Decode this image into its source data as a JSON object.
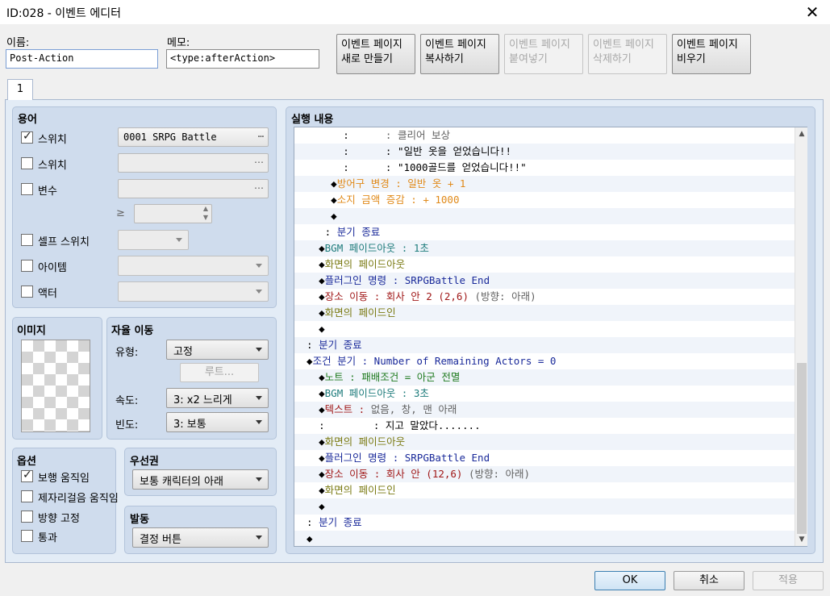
{
  "window": {
    "title": "ID:028 - 이벤트 에디터",
    "close_icon": "close-icon"
  },
  "header": {
    "name_label": "이름:",
    "name_value": "Post-Action",
    "memo_label": "메모:",
    "memo_value": "<type:afterAction>",
    "page_buttons": [
      {
        "line1": "이벤트 페이지",
        "line2": "새로 만들기",
        "enabled": true
      },
      {
        "line1": "이벤트 페이지",
        "line2": "복사하기",
        "enabled": true
      },
      {
        "line1": "이벤트 페이지",
        "line2": "붙여넣기",
        "enabled": false
      },
      {
        "line1": "이벤트 페이지",
        "line2": "삭제하기",
        "enabled": false
      },
      {
        "line1": "이벤트 페이지",
        "line2": "비우기",
        "enabled": true
      }
    ]
  },
  "tabs": [
    {
      "label": "1"
    }
  ],
  "conditions": {
    "title": "용어",
    "switch1_label": "스위치",
    "switch1_value": "0001 SRPG Battle",
    "switch2_label": "스위치",
    "variable_label": "변수",
    "gte_symbol": "≥",
    "self_switch_label": "셀프 스위치",
    "item_label": "아이템",
    "actor_label": "액터"
  },
  "image": {
    "title": "이미지"
  },
  "autonomous": {
    "title": "자율 이동",
    "type_label": "유형:",
    "type_value": "고정",
    "route_label": "루트...",
    "speed_label": "속도:",
    "speed_value": "3: x2 느리게",
    "freq_label": "빈도:",
    "freq_value": "3: 보통"
  },
  "options": {
    "title": "옵션",
    "walking": "보행 움직임",
    "stepping": "제자리걸음 움직임",
    "dir_fix": "방향 고정",
    "through": "통과"
  },
  "priority": {
    "title": "우선권",
    "value": "보통 캐릭터의 아래"
  },
  "trigger": {
    "title": "발동",
    "value": "결정 버튼"
  },
  "contents": {
    "title": "실행 내용",
    "lines": [
      [
        {
          "t": "        :      ",
          "c": ""
        },
        {
          "t": ": 클리어 보상",
          "c": "gray"
        }
      ],
      [
        {
          "t": "        :      ",
          "c": ""
        },
        {
          "t": ": \"일반 옷을 얻었습니다!!",
          "c": ""
        }
      ],
      [
        {
          "t": "        :      ",
          "c": ""
        },
        {
          "t": ": \"1000골드를 얻었습니다!!\"",
          "c": ""
        }
      ],
      [
        {
          "t": "      ◆",
          "c": ""
        },
        {
          "t": "방어구 변경 : 일반 옷 + 1",
          "c": "orange"
        }
      ],
      [
        {
          "t": "      ◆",
          "c": ""
        },
        {
          "t": "소지 금액 증감 : + 1000",
          "c": "orange"
        }
      ],
      [
        {
          "t": "      ◆",
          "c": ""
        }
      ],
      [
        {
          "t": "     : ",
          "c": ""
        },
        {
          "t": "분기 종료",
          "c": "navy"
        }
      ],
      [
        {
          "t": "    ◆",
          "c": ""
        },
        {
          "t": "BGM 페이드아웃 : 1초",
          "c": "teal"
        }
      ],
      [
        {
          "t": "    ◆",
          "c": ""
        },
        {
          "t": "화면의 페이드아웃",
          "c": "olive"
        }
      ],
      [
        {
          "t": "    ◆",
          "c": ""
        },
        {
          "t": "플러그인 명령 : SRPGBattle End",
          "c": "navy"
        }
      ],
      [
        {
          "t": "    ◆",
          "c": ""
        },
        {
          "t": "장소 이동 : 회사 안 2 (2,6)",
          "c": "brown"
        },
        {
          "t": " (방향: 아래)",
          "c": "gray"
        }
      ],
      [
        {
          "t": "    ◆",
          "c": ""
        },
        {
          "t": "화면의 페이드인",
          "c": "olive"
        }
      ],
      [
        {
          "t": "    ◆",
          "c": ""
        }
      ],
      [
        {
          "t": "  : ",
          "c": ""
        },
        {
          "t": "분기 종료",
          "c": "navy"
        }
      ],
      [
        {
          "t": "  ◆",
          "c": ""
        },
        {
          "t": "조건 분기 : Number of Remaining Actors = 0",
          "c": "navy"
        }
      ],
      [
        {
          "t": "    ◆",
          "c": ""
        },
        {
          "t": "노트 : 패배조건 = 아군 전멸",
          "c": "green"
        }
      ],
      [
        {
          "t": "    ◆",
          "c": ""
        },
        {
          "t": "BGM 페이드아웃 : 3초",
          "c": "teal"
        }
      ],
      [
        {
          "t": "    ◆",
          "c": ""
        },
        {
          "t": "텍스트 : ",
          "c": "brown"
        },
        {
          "t": "없음, 창, 맨 아래",
          "c": "gray"
        }
      ],
      [
        {
          "t": "    :        ",
          "c": ""
        },
        {
          "t": ": 지고 말았다.......",
          "c": ""
        }
      ],
      [
        {
          "t": "    ◆",
          "c": ""
        },
        {
          "t": "화면의 페이드아웃",
          "c": "olive"
        }
      ],
      [
        {
          "t": "    ◆",
          "c": ""
        },
        {
          "t": "플러그인 명령 : SRPGBattle End",
          "c": "navy"
        }
      ],
      [
        {
          "t": "    ◆",
          "c": ""
        },
        {
          "t": "장소 이동 : 회사 안 (12,6)",
          "c": "brown"
        },
        {
          "t": " (방향: 아래)",
          "c": "gray"
        }
      ],
      [
        {
          "t": "    ◆",
          "c": ""
        },
        {
          "t": "화면의 페이드인",
          "c": "olive"
        }
      ],
      [
        {
          "t": "    ◆",
          "c": ""
        }
      ],
      [
        {
          "t": "  : ",
          "c": ""
        },
        {
          "t": "분기 종료",
          "c": "navy"
        }
      ],
      [
        {
          "t": "  ◆",
          "c": ""
        }
      ]
    ]
  },
  "footer": {
    "ok": "OK",
    "cancel": "취소",
    "apply": "적용"
  }
}
